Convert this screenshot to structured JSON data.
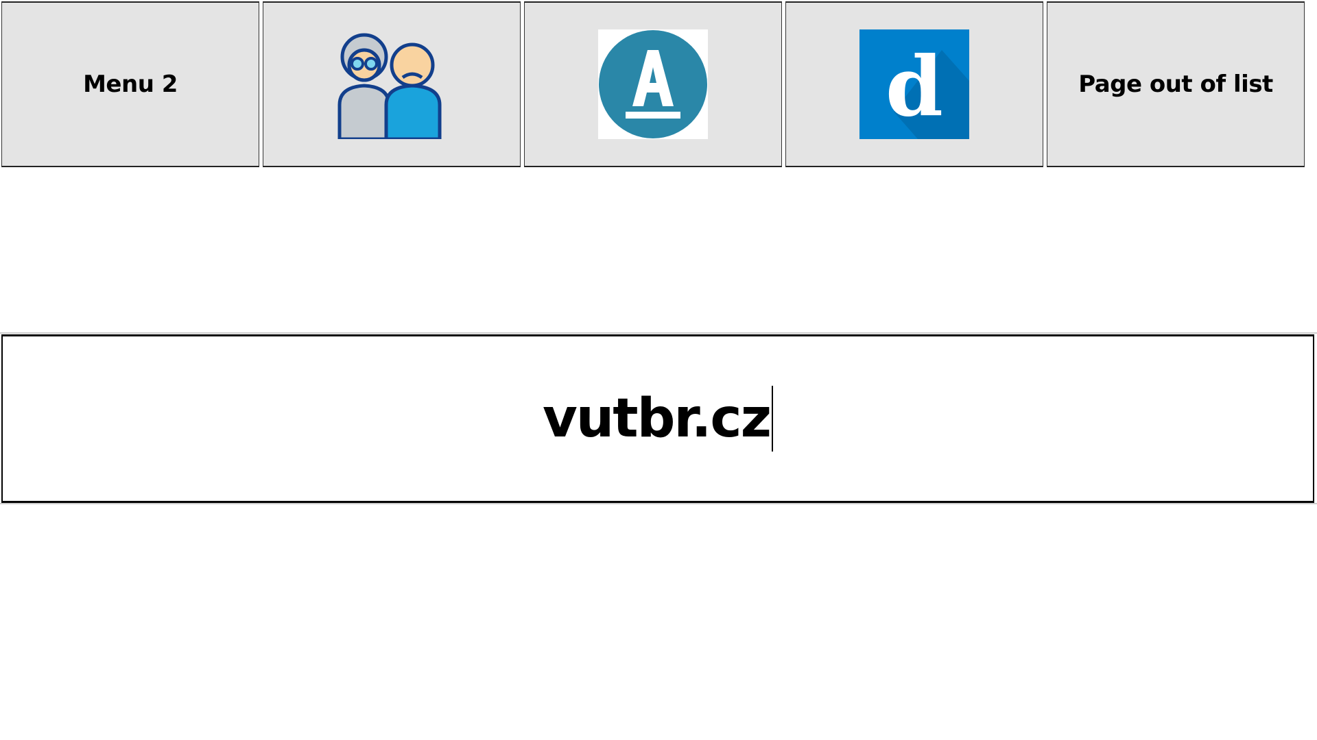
{
  "menu": {
    "items": [
      {
        "type": "text",
        "label": "Menu 2"
      },
      {
        "type": "icon",
        "icon": "elderly-couple-icon"
      },
      {
        "type": "icon",
        "icon": "letter-a-circle-logo",
        "color": "#2a87a8"
      },
      {
        "type": "icon",
        "icon": "letter-d-square-logo",
        "color": "#0080cc"
      },
      {
        "type": "text",
        "label": "Page out of list"
      }
    ]
  },
  "address": {
    "value": "vutbr.cz"
  }
}
